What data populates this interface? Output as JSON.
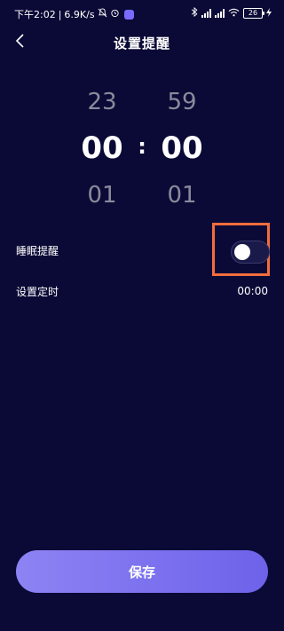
{
  "status_bar": {
    "time": "下午2:02",
    "speed": "6.9K/s",
    "battery": "26"
  },
  "header": {
    "title": "设置提醒"
  },
  "time_picker": {
    "hours": {
      "prev": "23",
      "current": "00",
      "next": "01"
    },
    "minutes": {
      "prev": "59",
      "current": "00",
      "next": "01"
    },
    "separator": ":"
  },
  "settings": {
    "sleep_reminder_label": "睡眠提醒",
    "sleep_reminder_on": false,
    "set_timer_label": "设置定时",
    "set_timer_value": "00:00"
  },
  "save_button": {
    "label": "保存"
  },
  "colors": {
    "background": "#0b0a36",
    "accent": "#7d72ef",
    "highlight_box": "#f26d3d"
  }
}
